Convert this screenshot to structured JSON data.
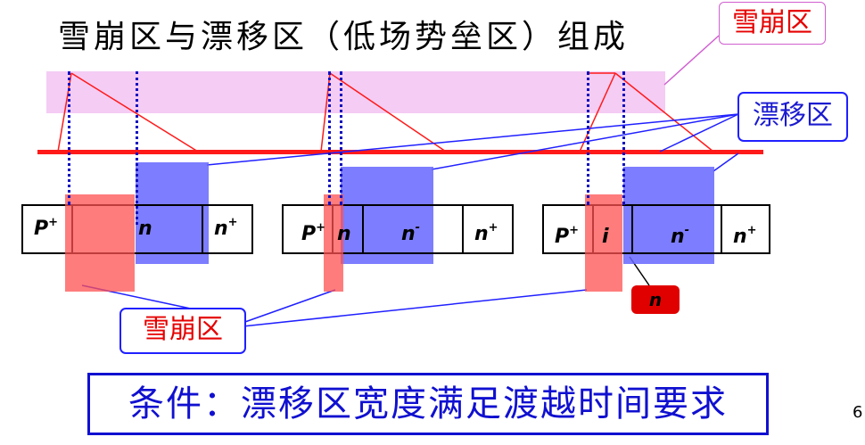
{
  "title": "雪崩区与漂移区（低场势垒区）组成",
  "callouts": {
    "avalanche_top": "雪崩区",
    "drift": "漂移区",
    "avalanche_bottom": "雪崩区",
    "n_badge": "n"
  },
  "devices": [
    {
      "cells": [
        "P+",
        "n",
        "n+"
      ]
    },
    {
      "cells": [
        "P+",
        "n",
        "n-",
        "n+"
      ]
    },
    {
      "cells": [
        "P+",
        "i",
        "n-",
        "n+"
      ]
    }
  ],
  "labels": {
    "d1_p": "P",
    "d1_p_sup": "+",
    "d1_n": "n",
    "d1_np": "n",
    "d1_np_sup": "+",
    "d2_p": "P",
    "d2_p_sup": "+",
    "d2_n": "n",
    "d2_nm": "n",
    "d2_nm_sup": "-",
    "d2_np": "n",
    "d2_np_sup": "+",
    "d3_p": "P",
    "d3_p_sup": "+",
    "d3_i": "i",
    "d3_nm": "n",
    "d3_nm_sup": "-",
    "d3_np": "n",
    "d3_np_sup": "+"
  },
  "condition": "条件：漂移区宽度满足渡越时间要求",
  "page_number": "6",
  "colors": {
    "avalanche_region": "#ff5050",
    "drift_region": "#6666ff",
    "avalanche_band": "#f4ccf4",
    "red_line": "#ff1a1a",
    "callout_border": "#2020ff"
  }
}
